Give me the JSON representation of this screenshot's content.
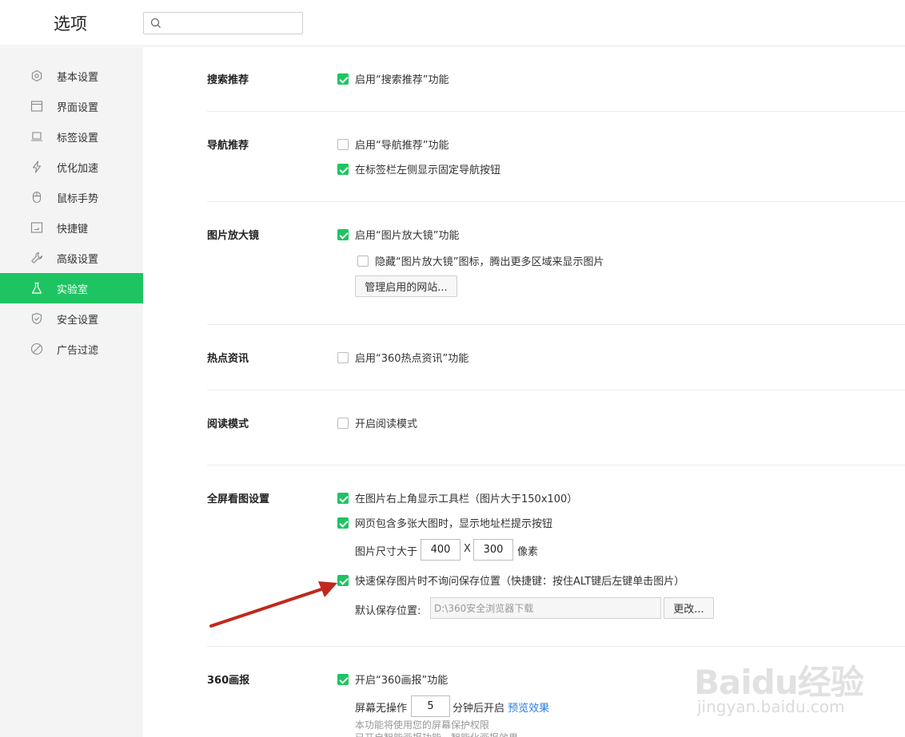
{
  "header": {
    "title": "选项",
    "search_placeholder": ""
  },
  "sidebar": {
    "items": [
      {
        "label": "基本设置",
        "icon": "gear-icon"
      },
      {
        "label": "界面设置",
        "icon": "window-icon"
      },
      {
        "label": "标签设置",
        "icon": "tab-icon"
      },
      {
        "label": "优化加速",
        "icon": "lightning-icon"
      },
      {
        "label": "鼠标手势",
        "icon": "mouse-icon"
      },
      {
        "label": "快捷键",
        "icon": "keyboard-icon"
      },
      {
        "label": "高级设置",
        "icon": "wrench-icon"
      },
      {
        "label": "实验室",
        "icon": "flask-icon"
      },
      {
        "label": "安全设置",
        "icon": "shield-icon"
      },
      {
        "label": "广告过滤",
        "icon": "block-icon"
      }
    ],
    "active": "实验室"
  },
  "sections": {
    "search_recommend": {
      "title": "搜索推荐",
      "opt1": "启用“搜索推荐”功能",
      "opt1_checked": true
    },
    "nav_recommend": {
      "title": "导航推荐",
      "opt1": "启用“导航推荐”功能",
      "opt1_checked": false,
      "opt2": "在标签栏左侧显示固定导航按钮",
      "opt2_checked": true
    },
    "magnifier": {
      "title": "图片放大镜",
      "opt1": "启用“图片放大镜”功能",
      "opt1_checked": true,
      "opt2": "隐藏“图片放大镜”图标，腾出更多区域来显示图片",
      "opt2_checked": false,
      "button": "管理启用的网站..."
    },
    "hot_news": {
      "title": "热点资讯",
      "opt1": "启用“360热点资讯”功能",
      "opt1_checked": false
    },
    "reading": {
      "title": "阅读模式",
      "opt1": "开启阅读模式",
      "opt1_checked": false
    },
    "fullscreen": {
      "title": "全屏看图设置",
      "opt1": "在图片右上角显示工具栏（图片大于150x100）",
      "opt1_checked": true,
      "opt2": "网页包含多张大图时，显示地址栏提示按钮",
      "opt2_checked": true,
      "size_label": "图片尺寸大于",
      "width": "400",
      "x_label": "X",
      "height": "300",
      "unit": "像素",
      "opt3": "快速保存图片时不询问保存位置（快捷键：按住ALT键后左键单击图片）",
      "opt3_checked": true,
      "save_label": "默认保存位置:",
      "save_path": "D:\\360安全浏览器下载",
      "change_button": "更改..."
    },
    "pictorial": {
      "title": "360画报",
      "opt1": "开启“360画报”功能",
      "opt1_checked": true,
      "idle_label": "屏幕无操作",
      "idle_minutes": "5",
      "idle_suffix": "分钟后开启",
      "preview_link": "预览效果",
      "note1": "本功能将使用您的屏幕保护权限",
      "note2": "已开启智能画报功能，智能化画报效果"
    }
  },
  "watermark": {
    "logo": "Baidu经验",
    "url": "jingyan.baidu.com"
  },
  "colors": {
    "accent": "#1fc462",
    "link": "#2b7de9",
    "arrow": "#c0281e"
  }
}
